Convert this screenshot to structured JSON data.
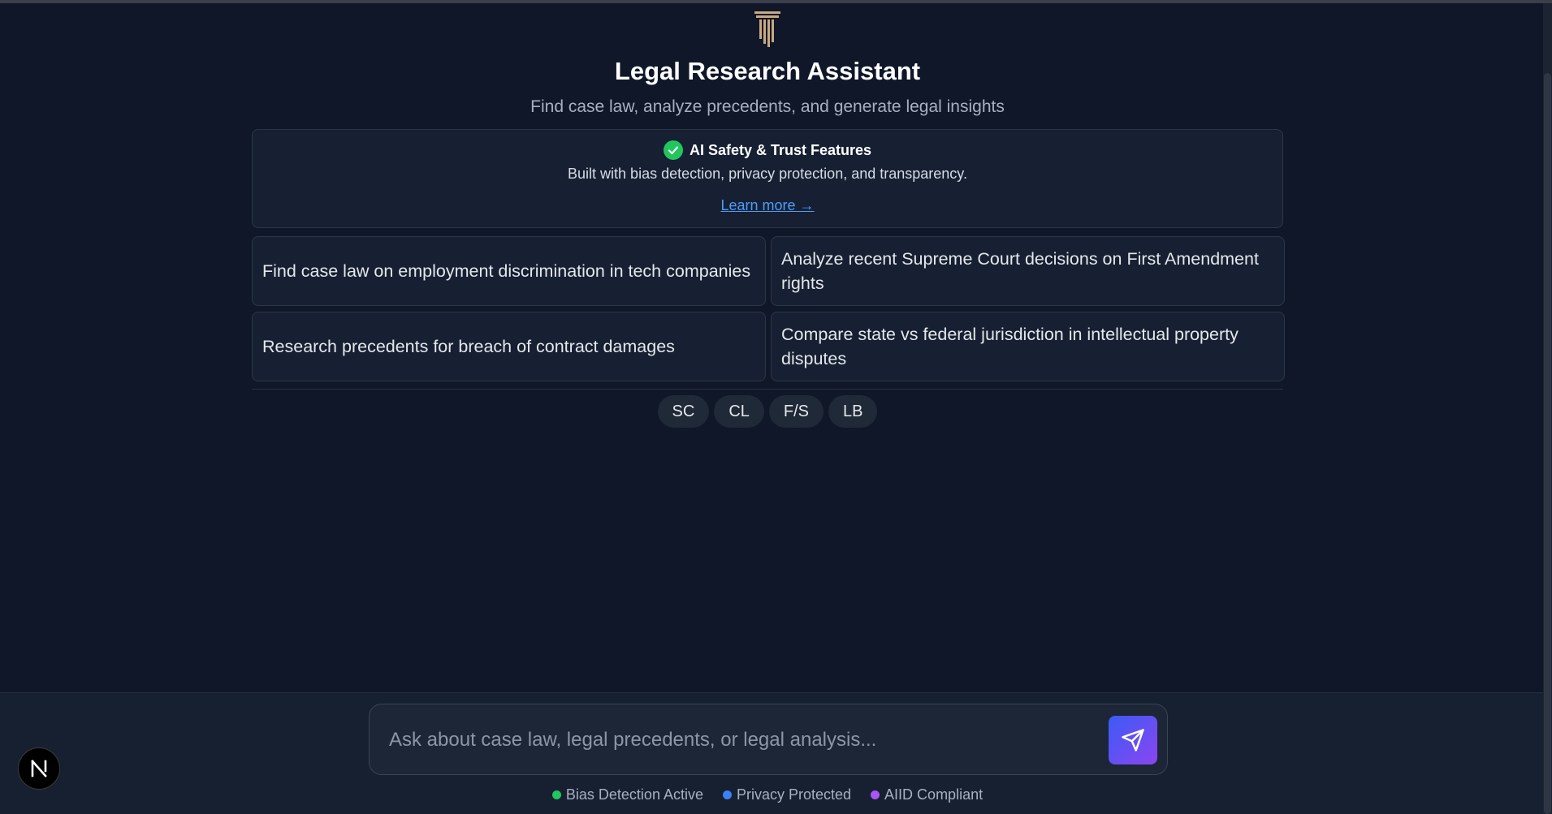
{
  "header": {
    "title": "Legal Research Assistant",
    "subtitle": "Find case law, analyze precedents, and generate legal insights",
    "logo_icon": "pillar-icon",
    "logo_color": "#c8a97e"
  },
  "trust": {
    "title": "AI Safety & Trust Features",
    "description": "Built with bias detection, privacy protection, and transparency.",
    "link_label": "Learn more →",
    "check_color": "#22c55e"
  },
  "suggestions": [
    "Find case law on employment discrimination in tech companies",
    "Analyze recent Supreme Court decisions on First Amendment rights",
    "Research precedents for breach of contract damages",
    "Compare state vs federal jurisdiction in intellectual property disputes"
  ],
  "chips": [
    "SC",
    "CL",
    "F/S",
    "LB"
  ],
  "chat": {
    "placeholder": "Ask about case law, legal precedents, or legal analysis...",
    "send_icon": "send-icon"
  },
  "status": [
    {
      "label": "Bias Detection Active",
      "color": "#22c55e"
    },
    {
      "label": "Privacy Protected",
      "color": "#3b82f6"
    },
    {
      "label": "AIID Compliant",
      "color": "#a855f7"
    }
  ],
  "badge": {
    "label": "N"
  }
}
